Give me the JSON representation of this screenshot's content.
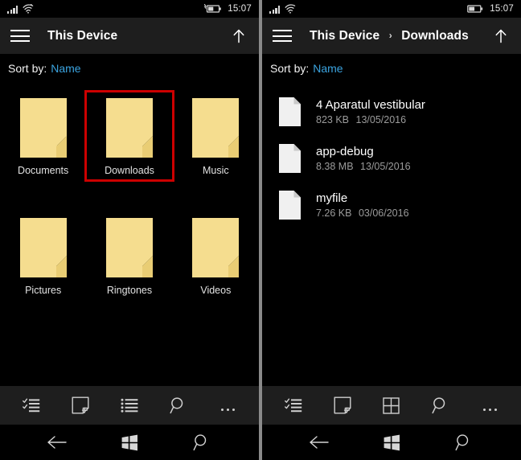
{
  "panels": [
    {
      "id": "left",
      "status": {
        "signal_icon": "signal-bars-icon",
        "wifi_icon": "wifi-icon",
        "battery_icon": "battery-charging-icon",
        "time": "15:07"
      },
      "titlebar": {
        "menu_icon": "hamburger-menu-icon",
        "title": "This Device",
        "breadcrumb": [
          "This Device"
        ],
        "up_icon": "up-arrow-icon"
      },
      "sort": {
        "label": "Sort by:",
        "value": "Name"
      },
      "view": "grid",
      "folders": [
        {
          "name": "Documents",
          "selected": false
        },
        {
          "name": "Downloads",
          "selected": true
        },
        {
          "name": "Music",
          "selected": false
        },
        {
          "name": "Pictures",
          "selected": false
        },
        {
          "name": "Ringtones",
          "selected": false
        },
        {
          "name": "Videos",
          "selected": false
        }
      ],
      "appbar": [
        {
          "icon": "select-list-icon",
          "name": "select-button"
        },
        {
          "icon": "new-folder-icon",
          "name": "new-folder-button"
        },
        {
          "icon": "list-view-icon",
          "name": "list-view-button"
        },
        {
          "icon": "search-icon",
          "name": "search-button"
        },
        {
          "icon": "more-icon",
          "name": "more-button"
        }
      ],
      "navbar": [
        {
          "icon": "back-arrow-icon",
          "name": "nav-back-button"
        },
        {
          "icon": "windows-logo-icon",
          "name": "nav-start-button"
        },
        {
          "icon": "search-icon",
          "name": "nav-search-button"
        }
      ]
    },
    {
      "id": "right",
      "status": {
        "signal_icon": "signal-bars-icon",
        "wifi_icon": "wifi-icon",
        "battery_icon": "battery-icon",
        "time": "15:07"
      },
      "titlebar": {
        "menu_icon": "hamburger-menu-icon",
        "title": "This Device > Downloads",
        "breadcrumb": [
          "This Device",
          "Downloads"
        ],
        "separator": "›",
        "up_icon": "up-arrow-icon"
      },
      "sort": {
        "label": "Sort by:",
        "value": "Name"
      },
      "view": "list",
      "files": [
        {
          "name": "4 Aparatul vestibular",
          "size": "823 KB",
          "date": "13/05/2016",
          "icon": "file-icon"
        },
        {
          "name": "app-debug",
          "size": "8.38 MB",
          "date": "13/05/2016",
          "icon": "file-icon"
        },
        {
          "name": "myfile",
          "size": "7.26 KB",
          "date": "03/06/2016",
          "icon": "file-icon"
        }
      ],
      "appbar": [
        {
          "icon": "select-list-icon",
          "name": "select-button"
        },
        {
          "icon": "new-folder-icon",
          "name": "new-folder-button"
        },
        {
          "icon": "grid-view-icon",
          "name": "grid-view-button"
        },
        {
          "icon": "search-icon",
          "name": "search-button"
        },
        {
          "icon": "more-icon",
          "name": "more-button"
        }
      ],
      "navbar": [
        {
          "icon": "back-arrow-icon",
          "name": "nav-back-button"
        },
        {
          "icon": "windows-logo-icon",
          "name": "nav-start-button"
        },
        {
          "icon": "search-icon",
          "name": "nav-search-button"
        }
      ]
    }
  ],
  "colors": {
    "background": "#000000",
    "chrome": "#1e1e1e",
    "accent": "#3ba4e0",
    "folder": "#f5dd8f",
    "highlight": "#cc0000",
    "icon": "#cfcfcf",
    "subtext": "#9b9b9b",
    "divider": "#8a8a8a"
  }
}
